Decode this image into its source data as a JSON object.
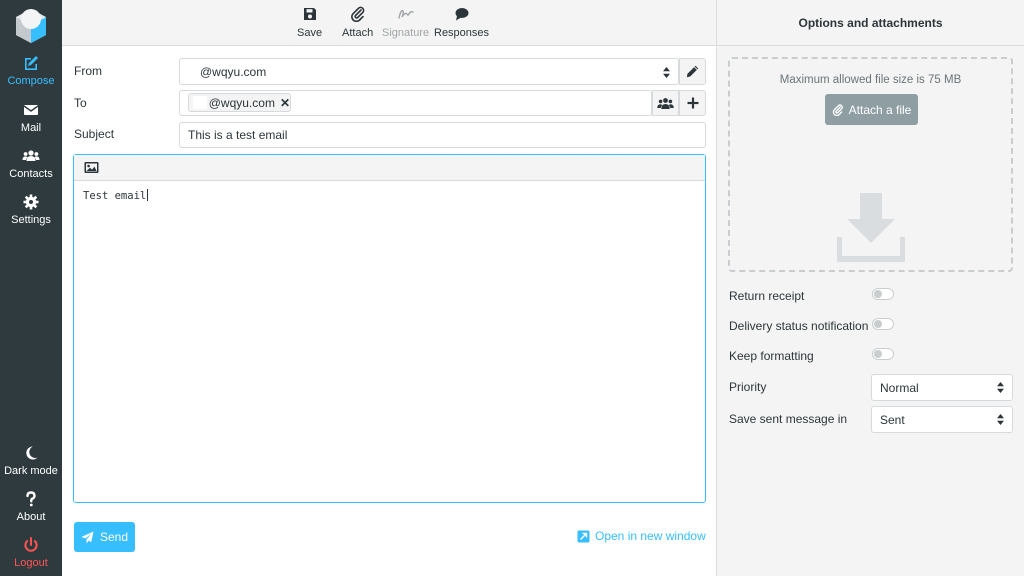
{
  "sidebar": {
    "compose": "Compose",
    "mail": "Mail",
    "contacts": "Contacts",
    "settings": "Settings",
    "dark_mode": "Dark mode",
    "about": "About",
    "logout": "Logout",
    "active_color": "#37beff",
    "logout_color": "#ff5552"
  },
  "toolbar": {
    "save": "Save",
    "attach": "Attach",
    "signature": "Signature",
    "responses": "Responses"
  },
  "form": {
    "from_label": "From",
    "from_value": "@wqyu.com",
    "to_label": "To",
    "to_recipient": "@wqyu.com",
    "subject_label": "Subject",
    "subject_value": "This is a test email",
    "body": "Test email"
  },
  "actions": {
    "send": "Send",
    "open_new_window": "Open in new window"
  },
  "options": {
    "title": "Options and attachments",
    "max_size": "Maximum allowed file size is 75 MB",
    "attach_file": "Attach a file",
    "return_receipt": "Return receipt",
    "delivery_status": "Delivery status notification",
    "keep_formatting": "Keep formatting",
    "priority_label": "Priority",
    "priority_value": "Normal",
    "save_sent_label": "Save sent message in",
    "save_sent_value": "Sent",
    "toggles": {
      "return_receipt": false,
      "delivery_status": false,
      "keep_formatting": false
    }
  },
  "icons": [
    "logo-icon",
    "compose-icon",
    "mail-icon",
    "contacts-icon",
    "settings-icon",
    "moon-icon",
    "question-icon",
    "power-icon",
    "save-icon",
    "paperclip-icon",
    "signature-icon",
    "comment-icon",
    "pencil-icon",
    "address-book-icon",
    "plus-icon",
    "image-icon",
    "paper-plane-icon",
    "external-link-icon",
    "download-icon",
    "up-down-caret-icon"
  ]
}
